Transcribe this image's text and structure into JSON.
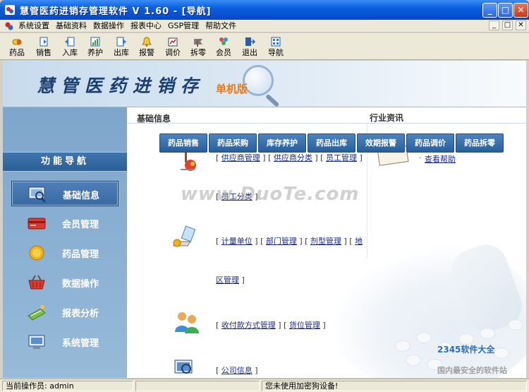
{
  "window": {
    "title": "慧管医药进销存管理软件 V 1.60 - [导航]",
    "min_label": "_",
    "max_label": "□",
    "close_label": "✕"
  },
  "menu": {
    "items": [
      "系统设置",
      "基础资料",
      "数据操作",
      "报表中心",
      "GSP管理",
      "帮助文件"
    ],
    "mdi": [
      "_",
      "□",
      "✕"
    ]
  },
  "toolbar": {
    "items": [
      {
        "label": "药品",
        "icon": "pill-icon"
      },
      {
        "label": "销售",
        "icon": "sale-icon"
      },
      {
        "label": "入库",
        "icon": "stock-in-icon"
      },
      {
        "label": "养护",
        "icon": "maintain-icon"
      },
      {
        "label": "出库",
        "icon": "stock-out-icon"
      },
      {
        "label": "报警",
        "icon": "alarm-bell-icon"
      },
      {
        "label": "调价",
        "icon": "price-adjust-icon"
      },
      {
        "label": "拆零",
        "icon": "split-icon"
      },
      {
        "label": "会员",
        "icon": "member-icon"
      },
      {
        "label": "退出",
        "icon": "exit-icon"
      },
      {
        "label": "导航",
        "icon": "navigation-icon"
      }
    ]
  },
  "banner": {
    "brand": "慧管医药进销存",
    "edition": "单机版"
  },
  "sidebar": {
    "header": "功能导航",
    "items": [
      {
        "label": "基础信息",
        "icon": "basic-info-icon",
        "active": true
      },
      {
        "label": "会员管理",
        "icon": "member-card-icon",
        "active": false
      },
      {
        "label": "药品管理",
        "icon": "coin-icon",
        "active": false
      },
      {
        "label": "数据操作",
        "icon": "basket-icon",
        "active": false
      },
      {
        "label": "报表分析",
        "icon": "report-icon",
        "active": false
      },
      {
        "label": "系统管理",
        "icon": "system-icon",
        "active": false
      }
    ]
  },
  "main": {
    "section_title": "基础信息",
    "news_title": "行业资讯",
    "help_link": "查看帮助",
    "tabs": [
      "药品销售",
      "药品采购",
      "库存养护",
      "药品出库",
      "效期报警",
      "药品调价",
      "药品拆零"
    ],
    "groups": [
      {
        "links": [
          "供应商管理",
          "供应商分类",
          "员工管理"
        ],
        "icon": "supplier-icon"
      },
      {
        "links": [
          "员工分类"
        ]
      },
      {
        "links": [
          "计量单位",
          "部门管理",
          "剂型管理",
          "地"
        ],
        "icon": "unit-icon"
      },
      {
        "links": [
          "区管理"
        ]
      },
      {
        "links": [
          "收付款方式管理",
          "货位管理"
        ],
        "icon": "payment-icon"
      },
      {
        "links": [
          "公司信息"
        ],
        "icon": "company-icon"
      }
    ],
    "watermark": "www.DuoTe.com",
    "corner_mark": "2345软件大全",
    "corner_mark2": "国内最安全的软件站"
  },
  "status": {
    "operator": "当前操作员: admin",
    "message": "您未使用加密狗设备!"
  }
}
